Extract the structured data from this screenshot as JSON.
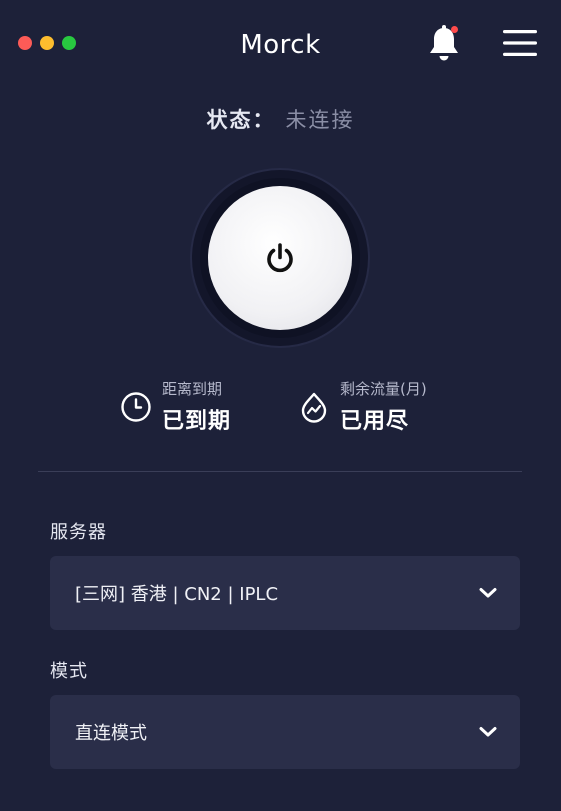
{
  "window": {
    "title": "Morck",
    "traffic_lights": {
      "close": "#fc5b57",
      "minimize": "#fdbd2e",
      "zoom": "#28c840"
    },
    "background": "#1d2139"
  },
  "header": {
    "bell_icon": "bell-icon",
    "menu_icon": "hamburger-menu-icon",
    "notification_dot_color": "#ff4b4b"
  },
  "status": {
    "label": "状态：",
    "value": "未连接"
  },
  "power": {
    "icon": "power-icon"
  },
  "info": {
    "expiry": {
      "icon": "clock-icon",
      "label": "距离到期",
      "value": "已到期"
    },
    "traffic": {
      "icon": "droplet-chart-icon",
      "label": "剩余流量(月)",
      "value": "已用尽"
    }
  },
  "server": {
    "label": "服务器",
    "selected": "[三网] 香港 | CN2 | IPLC"
  },
  "mode": {
    "label": "模式",
    "selected": "直连模式"
  }
}
